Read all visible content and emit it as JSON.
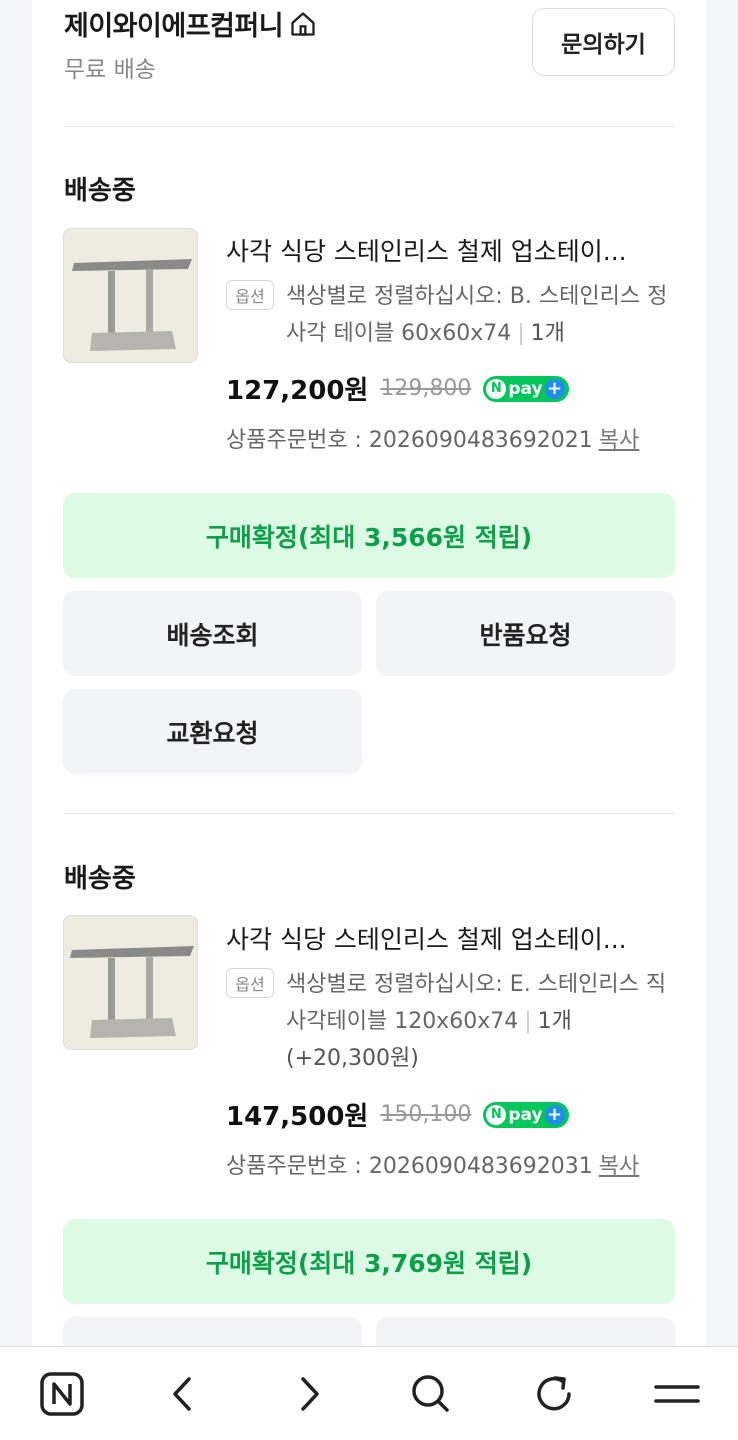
{
  "store": {
    "name": "제이와이에프컴퍼니",
    "shipping": "무료 배송",
    "inquiry_label": "문의하기"
  },
  "orders": [
    {
      "status": "배송중",
      "title": "사각 식당 스테인리스 철제 업소테이...",
      "option_badge": "옵션",
      "option_text": "색상별로 정렬하십시오: B. 스테인리스 정사각 테이블 60x60x74",
      "quantity": "1개",
      "price": "127,200원",
      "original_price": "129,800",
      "npay_label": "pay",
      "order_no_label": "상품주문번호 : 2026090483692021",
      "copy_label": "복사",
      "confirm_label": "구매확정(최대 3,566원 적립)",
      "actions": [
        "배송조회",
        "반품요청",
        "교환요청"
      ]
    },
    {
      "status": "배송중",
      "title": "사각 식당 스테인리스 철제 업소테이...",
      "option_badge": "옵션",
      "option_text": "색상별로 정렬하십시오: E. 스테인리스 직사각테이블 120x60x74",
      "quantity": "1개 (+20,300원)",
      "price": "147,500원",
      "original_price": "150,100",
      "npay_label": "pay",
      "order_no_label": "상품주문번호 : 2026090483692031",
      "copy_label": "복사",
      "confirm_label": "구매확정(최대 3,769원 적립)"
    }
  ],
  "nav": {
    "icons": [
      "naver-home-icon",
      "back-icon",
      "forward-icon",
      "search-icon",
      "refresh-icon",
      "menu-icon"
    ]
  },
  "colors": {
    "accent_green": "#0e9f4a",
    "confirm_bg": "#dcfae4",
    "npay_green": "#03c75a"
  }
}
